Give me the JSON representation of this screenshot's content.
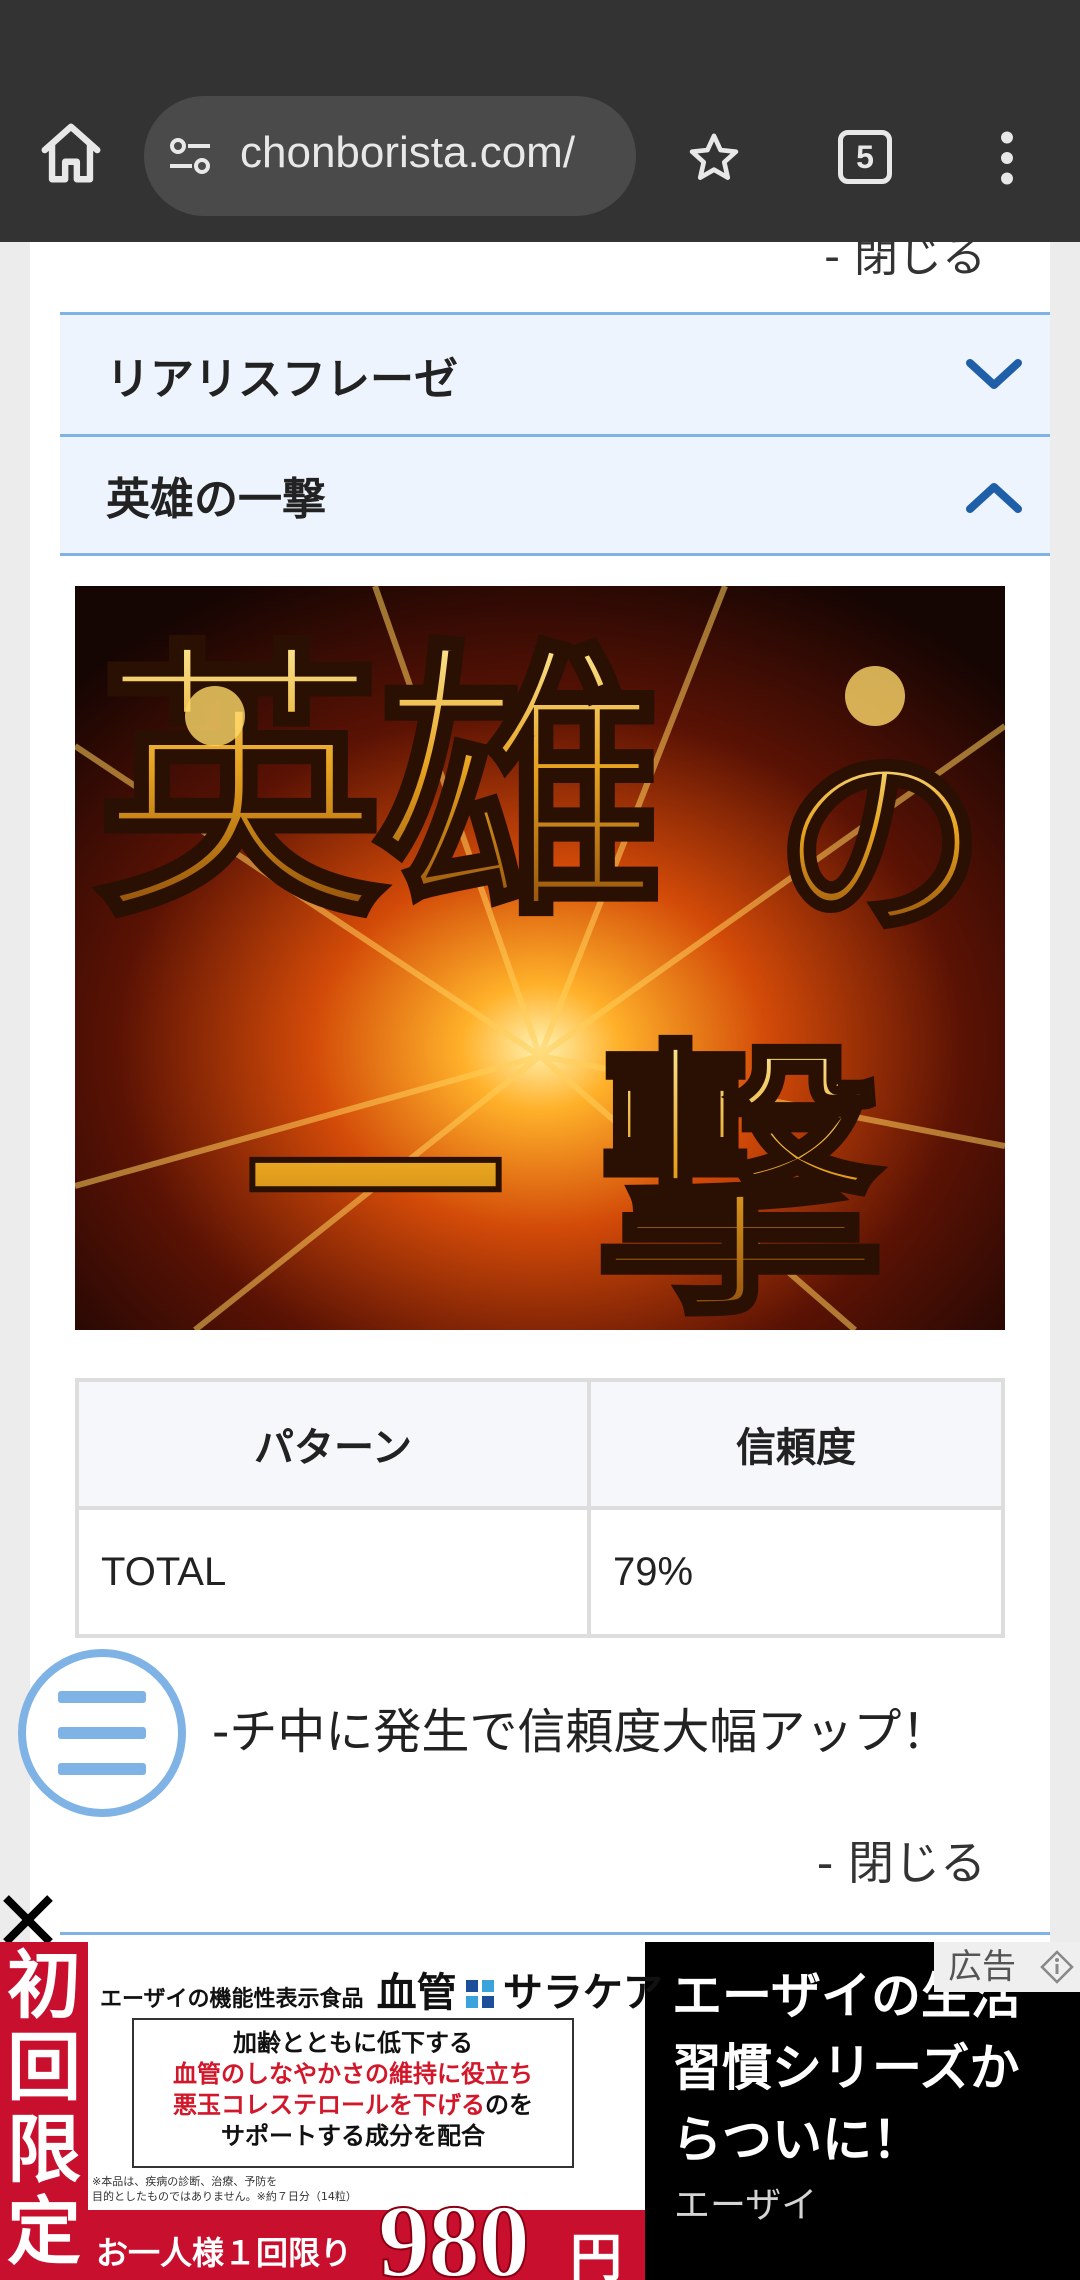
{
  "browser": {
    "url": "chonborista.com/",
    "tab_count": "5",
    "icons": [
      "home-icon",
      "site-settings-icon",
      "star-icon",
      "tab-switcher-icon",
      "more-menu-icon"
    ]
  },
  "page": {
    "close_top_label": "- 閉じる",
    "accordion": [
      {
        "label": "リアリスフレーゼ",
        "state": "collapsed",
        "icon": "chevron-down-icon"
      },
      {
        "label": "英雄の一撃",
        "state": "expanded",
        "icon": "chevron-up-icon"
      }
    ],
    "hero_image_text": "英雄の一撃",
    "table": {
      "headers": [
        "パターン",
        "信頼度"
      ],
      "rows": [
        [
          "TOTAL",
          "79%"
        ]
      ]
    },
    "note": "-チ中に発生で信頼度大幅アップ！",
    "close_bottom_label": "- 閉じる",
    "accent_color": "#7fb2e5"
  },
  "ad": {
    "red_label": [
      "初",
      "回",
      "限",
      "定"
    ],
    "brand_small": "エーザイの機能性表示食品",
    "brand_big_1": "血管",
    "brand_big_2": "サラケア",
    "box_line1": "加齢とともに低下する",
    "box_line2": "血管のしなやかさの維持に役立ち",
    "box_line3a": "悪玉コレステロールを下げる",
    "box_line3b": "のを",
    "box_line4": "サポートする成分を配合",
    "fine_1": "※本品は、疾病の診断、治療、予防を",
    "fine_2": "目的としたものではありません。※約７日分（14粒）",
    "once": "お一人様１回限り",
    "price": "980",
    "yen": "円",
    "title": "エーザイの生活習慣シリーズからついに！",
    "advertiser": "エーザイ",
    "ad_label": "広告"
  }
}
